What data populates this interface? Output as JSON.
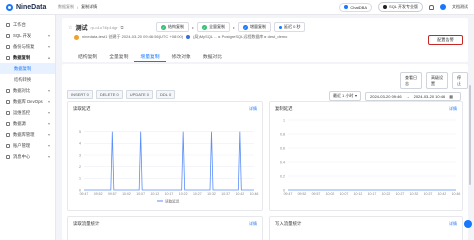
{
  "app": {
    "logo_text": "NineData"
  },
  "breadcrumb": [
    "数据复制",
    "复制详情"
  ],
  "topbar": {
    "chat_label": "ChatDBA",
    "sql_label": "SQL 开发专业版",
    "user_label": "文档测试"
  },
  "sidebar": {
    "items": [
      {
        "label": "工作台",
        "caret": ""
      },
      {
        "label": "SQL 开发",
        "caret": "▾"
      },
      {
        "label": "备份与恢复",
        "caret": "▾"
      },
      {
        "label": "数据复制",
        "caret": "▴"
      },
      {
        "label": "数据复制",
        "caret": ""
      },
      {
        "label": "结构转换",
        "caret": ""
      },
      {
        "label": "数据对比",
        "caret": "▾"
      },
      {
        "label": "数据库 DevOps",
        "caret": "▾"
      },
      {
        "label": "运维监控",
        "caret": "▾"
      },
      {
        "label": "数据源",
        "caret": "▾"
      },
      {
        "label": "数据库管理",
        "caret": "▾"
      },
      {
        "label": "账户管理",
        "caret": "▾"
      },
      {
        "label": "消息中心",
        "caret": "▾"
      }
    ]
  },
  "task": {
    "name": "测试",
    "id": "rp-o1u74lp1dgr",
    "creator": "ninedata-test1 创建于 2024-03-20 09:46:56(UTC +08:00)",
    "route": "(局)MySQL ... ▸ PostgreSQL远程数据库 ▸ dest_demo"
  },
  "stages": [
    {
      "label": "结构复制",
      "icon": "✓"
    },
    {
      "label": "全量复制",
      "icon": "✓"
    },
    {
      "label": "增量复制",
      "icon": "✓"
    },
    {
      "label": "延迟 0 秒",
      "icon": ""
    }
  ],
  "alert_button": "配置告警",
  "tabs": [
    {
      "label": "结构复制",
      "active": false
    },
    {
      "label": "全量复制",
      "active": false
    },
    {
      "label": "增量复制",
      "active": true
    },
    {
      "label": "修改对象",
      "active": false
    },
    {
      "label": "数据对比",
      "active": false
    }
  ],
  "op_tags": [
    "INSERT 0",
    "DELETE 0",
    "UPDATE 0",
    "DDL 0"
  ],
  "buttons": {
    "view_log": "查看日志",
    "settings": "高级设置",
    "stop": "停止"
  },
  "range": {
    "preset": "最近 1 小时",
    "start": "2024-03-20 09:46",
    "end": "2024-03-20 10:46",
    "sep": "→"
  },
  "panels": {
    "read_latency": {
      "title": "读取延迟",
      "link": "详情",
      "legend": "读取延迟"
    },
    "replicate_latency": {
      "title": "复制延迟",
      "link": "详情"
    },
    "read_traffic": {
      "title": "读取流量统计",
      "link": "详情"
    },
    "write_traffic": {
      "title": "写入流量统计",
      "link": "详情"
    }
  },
  "colors": {
    "accent": "#1677ff",
    "success": "#2fbf71",
    "alert_border": "#c62828"
  },
  "chart_data": [
    {
      "type": "line",
      "title": "读取延迟",
      "x": [
        "09:47",
        "09:52",
        "09:57",
        "10:02",
        "10:07",
        "10:12",
        "10:17",
        "10:22",
        "10:27",
        "10:32",
        "10:37",
        "10:42",
        "10:46"
      ],
      "series": [
        {
          "name": "读取延迟",
          "values": [
            0,
            0,
            5,
            0,
            5,
            0,
            0,
            5,
            0,
            5,
            0,
            5,
            0
          ]
        }
      ],
      "ylim": [
        0,
        6
      ],
      "yticks": [
        0,
        1,
        2,
        3,
        4,
        5
      ],
      "grid": true,
      "legend": "bottom-center"
    },
    {
      "type": "line",
      "title": "复制延迟",
      "x": [
        "09:47",
        "09:52",
        "09:57",
        "10:02",
        "10:07",
        "10:12",
        "10:17",
        "10:22",
        "10:27",
        "10:32",
        "10:37",
        "10:42",
        "10:46"
      ],
      "series": [
        {
          "name": "",
          "values": [
            0,
            0,
            0,
            0,
            0,
            0,
            0,
            0,
            0,
            0,
            0,
            0,
            0
          ]
        }
      ],
      "ylim": [
        0,
        1
      ],
      "yticks": [
        0,
        0.2,
        0.4,
        0.6,
        0.8,
        1
      ],
      "grid": true
    }
  ]
}
